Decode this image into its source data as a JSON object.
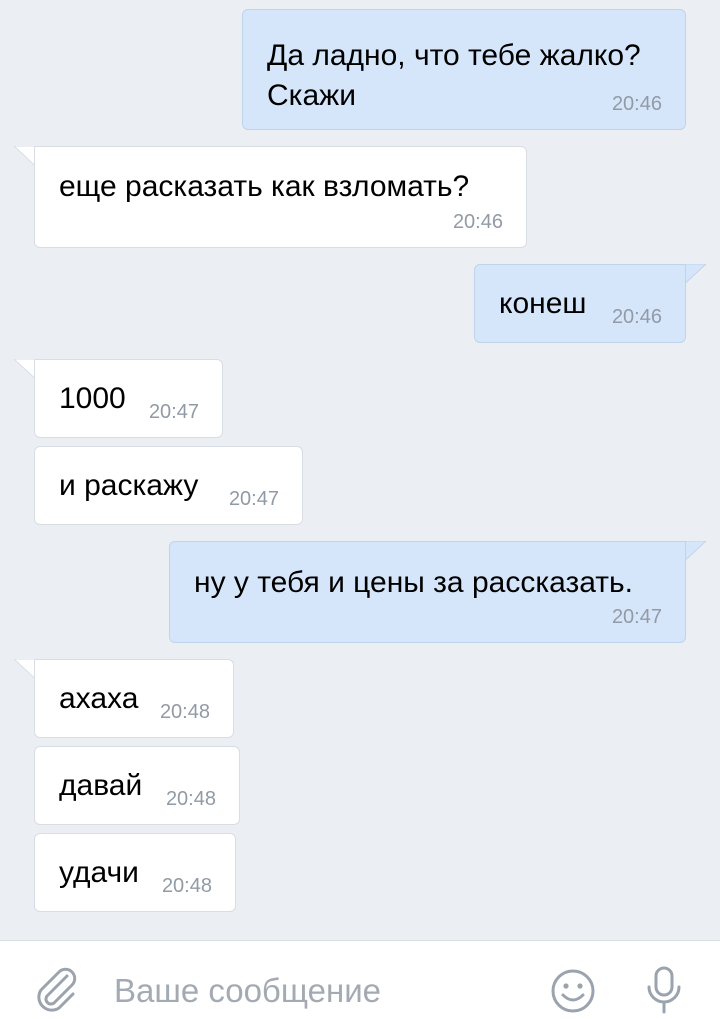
{
  "messages": [
    {
      "dir": "out",
      "text": "Да ладно, что тебе жалко?\nСкажи",
      "time": "20:46"
    },
    {
      "dir": "in",
      "text": "еще расказать как взломать?",
      "time": "20:46"
    },
    {
      "dir": "out",
      "text": "конеш",
      "time": "20:46"
    },
    {
      "dir": "in",
      "text": "1000",
      "time": "20:47"
    },
    {
      "dir": "in",
      "text": "и раскажу",
      "time": "20:47"
    },
    {
      "dir": "out",
      "text": "ну у тебя и цены за рассказать.",
      "time": "20:47"
    },
    {
      "dir": "in",
      "text": "ахаха",
      "time": "20:48"
    },
    {
      "dir": "in",
      "text": "давай",
      "time": "20:48"
    },
    {
      "dir": "in",
      "text": "удачи",
      "time": "20:48"
    }
  ],
  "composer": {
    "placeholder": "Ваше сообщение",
    "attach_icon": "paperclip-icon",
    "emoji_icon": "smiley-icon",
    "mic_icon": "microphone-icon"
  },
  "colors": {
    "background": "#ebeff4",
    "incoming_bubble": "#ffffff",
    "outgoing_bubble": "#d6e6fa",
    "timestamp": "#929aa6",
    "icon": "#9aa3ae"
  }
}
